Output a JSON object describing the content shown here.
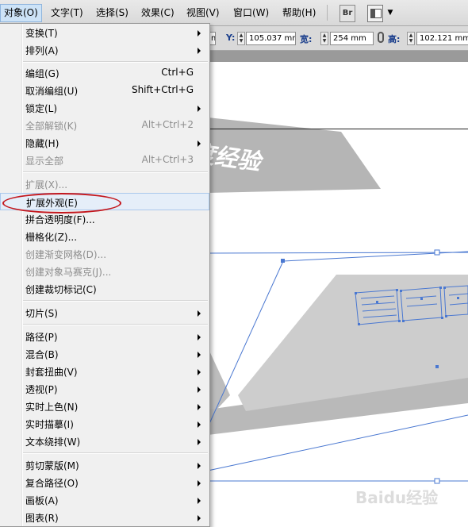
{
  "menubar": {
    "items": [
      "对象(O)",
      "文字(T)",
      "选择(S)",
      "效果(C)",
      "视图(V)",
      "窗口(W)",
      "帮助(H)"
    ],
    "bridge_label": "Br",
    "arrow": "▼"
  },
  "control_bar": {
    "partial_value": "m",
    "y_label": "Y:",
    "y_value": "105.037 mm",
    "width_label": "宽:",
    "width_value": "254 mm",
    "height_label": "高:",
    "height_value": "102.121 mm"
  },
  "canvas": {
    "artwork_text": "度经验",
    "watermark": "Baidu经验",
    "colors": {
      "dark_shape": "#b0b0b0",
      "light_shape": "#cfcfcf",
      "selection": "#4a78d1"
    }
  },
  "menu": {
    "items": [
      {
        "label": "变换(T)",
        "shortcut": "",
        "submenu": true,
        "disabled": false
      },
      {
        "label": "排列(A)",
        "shortcut": "",
        "submenu": true,
        "disabled": false
      },
      {
        "label": "编组(G)",
        "shortcut": "Ctrl+G",
        "submenu": false,
        "disabled": false
      },
      {
        "label": "取消编组(U)",
        "shortcut": "Shift+Ctrl+G",
        "submenu": false,
        "disabled": false
      },
      {
        "label": "锁定(L)",
        "shortcut": "",
        "submenu": true,
        "disabled": false
      },
      {
        "label": "全部解锁(K)",
        "shortcut": "Alt+Ctrl+2",
        "submenu": false,
        "disabled": true
      },
      {
        "label": "隐藏(H)",
        "shortcut": "",
        "submenu": true,
        "disabled": false
      },
      {
        "label": "显示全部",
        "shortcut": "Alt+Ctrl+3",
        "submenu": false,
        "disabled": true
      },
      {
        "label": "扩展(X)...",
        "shortcut": "",
        "submenu": false,
        "disabled": true
      },
      {
        "label": "扩展外观(E)",
        "shortcut": "",
        "submenu": false,
        "disabled": false
      },
      {
        "label": "拼合透明度(F)...",
        "shortcut": "",
        "submenu": false,
        "disabled": false
      },
      {
        "label": "栅格化(Z)...",
        "shortcut": "",
        "submenu": false,
        "disabled": false
      },
      {
        "label": "创建渐变网格(D)...",
        "shortcut": "",
        "submenu": false,
        "disabled": true
      },
      {
        "label": "创建对象马赛克(J)...",
        "shortcut": "",
        "submenu": false,
        "disabled": true
      },
      {
        "label": "创建裁切标记(C)",
        "shortcut": "",
        "submenu": false,
        "disabled": false
      },
      {
        "label": "切片(S)",
        "shortcut": "",
        "submenu": true,
        "disabled": false
      },
      {
        "label": "路径(P)",
        "shortcut": "",
        "submenu": true,
        "disabled": false
      },
      {
        "label": "混合(B)",
        "shortcut": "",
        "submenu": true,
        "disabled": false
      },
      {
        "label": "封套扭曲(V)",
        "shortcut": "",
        "submenu": true,
        "disabled": false
      },
      {
        "label": "透视(P)",
        "shortcut": "",
        "submenu": true,
        "disabled": false
      },
      {
        "label": "实时上色(N)",
        "shortcut": "",
        "submenu": true,
        "disabled": false
      },
      {
        "label": "实时描摹(I)",
        "shortcut": "",
        "submenu": true,
        "disabled": false
      },
      {
        "label": "文本绕排(W)",
        "shortcut": "",
        "submenu": true,
        "disabled": false
      },
      {
        "label": "剪切蒙版(M)",
        "shortcut": "",
        "submenu": true,
        "disabled": false
      },
      {
        "label": "复合路径(O)",
        "shortcut": "",
        "submenu": true,
        "disabled": false
      },
      {
        "label": "画板(A)",
        "shortcut": "",
        "submenu": true,
        "disabled": false
      },
      {
        "label": "图表(R)",
        "shortcut": "",
        "submenu": true,
        "disabled": false
      }
    ]
  }
}
